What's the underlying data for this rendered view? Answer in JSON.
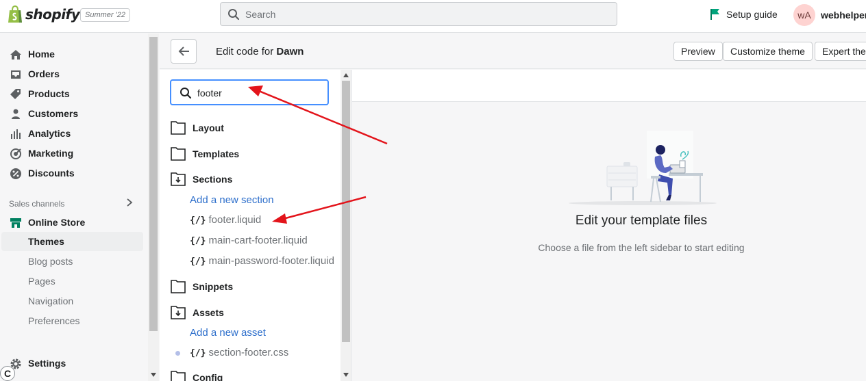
{
  "topbar": {
    "logo_text": "shopify",
    "edition_badge": "Summer '22",
    "search_placeholder": "Search",
    "setup_guide": "Setup guide",
    "avatar_initials": "wA",
    "store_name": "webhelper"
  },
  "nav": {
    "items": [
      {
        "label": "Home",
        "icon": "home-icon"
      },
      {
        "label": "Orders",
        "icon": "orders-icon"
      },
      {
        "label": "Products",
        "icon": "tag-icon"
      },
      {
        "label": "Customers",
        "icon": "person-icon"
      },
      {
        "label": "Analytics",
        "icon": "bar-chart-icon"
      },
      {
        "label": "Marketing",
        "icon": "target-icon"
      },
      {
        "label": "Discounts",
        "icon": "discount-icon"
      }
    ],
    "sales_channels_label": "Sales channels",
    "online_store": "Online Store",
    "sub_items": [
      "Themes",
      "Blog posts",
      "Pages",
      "Navigation",
      "Preferences"
    ],
    "active_sub_item": "Themes",
    "settings": "Settings",
    "badge": "C"
  },
  "editor": {
    "title_prefix": "Edit code for",
    "theme_name": "Dawn",
    "buttons": {
      "preview": "Preview",
      "customize": "Customize theme",
      "expert": "Expert themes"
    }
  },
  "tree": {
    "search_value": "footer",
    "folders": {
      "layout": "Layout",
      "templates": "Templates",
      "sections": "Sections",
      "snippets": "Snippets",
      "assets": "Assets",
      "config": "Config"
    },
    "add_section": "Add a new section",
    "add_asset": "Add a new asset",
    "file_prefix": "{/}",
    "section_files": [
      "footer.liquid",
      "main-cart-footer.liquid",
      "main-password-footer.liquid"
    ],
    "asset_files": [
      "section-footer.css"
    ]
  },
  "main": {
    "empty_title": "Edit your template files",
    "empty_subtitle": "Choose a file from the left sidebar to start editing"
  },
  "colors": {
    "accent": "#2c6ecb",
    "focus_ring": "#458fff",
    "annotation_arrow": "#e3141b",
    "online_store_icon": "#008060"
  }
}
